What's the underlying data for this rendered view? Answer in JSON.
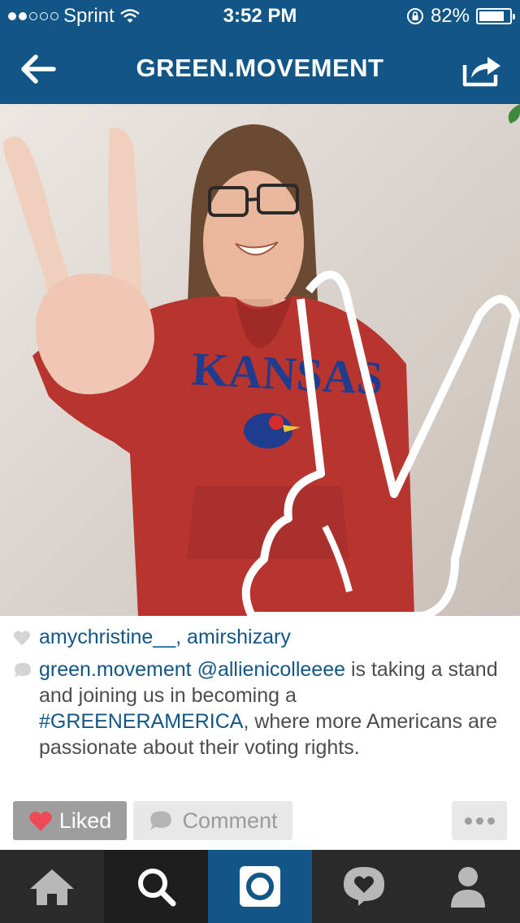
{
  "status_bar": {
    "carrier": "Sprint",
    "time": "3:52 PM",
    "battery_percent_label": "82%",
    "battery_level": 0.82,
    "signal_bars_filled": 2,
    "signal_bars_total": 5
  },
  "nav": {
    "title": "GREEN.MOVEMENT",
    "back_icon": "back-arrow-icon",
    "share_icon": "share-icon"
  },
  "post": {
    "likes": {
      "user1": "amychristine__",
      "separator": ", ",
      "user2": "amirshizary"
    },
    "caption": {
      "username": "green.movement",
      "mention": "@allienicolleeee",
      "text_before_tag": " is taking a stand and joining us in becoming a ",
      "hashtag": "#GREENERAMERICA",
      "text_after_tag": ", where more Americans are passionate about their voting rights."
    },
    "photo": {
      "sweatshirt_text": "KANSAS"
    },
    "actions": {
      "liked_label": "Liked",
      "comment_label": "Comment"
    }
  },
  "tabs": [
    {
      "name": "home",
      "icon": "home-icon"
    },
    {
      "name": "explore",
      "icon": "search-icon"
    },
    {
      "name": "camera",
      "icon": "camera-icon",
      "active": true
    },
    {
      "name": "activity",
      "icon": "activity-icon"
    },
    {
      "name": "profile",
      "icon": "profile-icon"
    }
  ],
  "colors": {
    "brand": "#125688",
    "like_red": "#ed4956",
    "tabbar": "#2a2a2a"
  }
}
